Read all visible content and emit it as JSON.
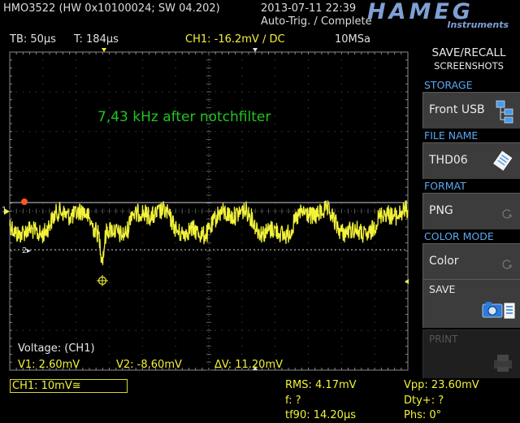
{
  "header": {
    "model": "HMO3522 (HW 0x10100024; SW 04.202)",
    "datetime": "2013-07-11 22:39",
    "status": "Auto-Trig. / Complete",
    "logo": "HAMEG",
    "logo_sub": "Instruments"
  },
  "info_bar": {
    "timebase": "TB: 50µs",
    "trigger_time": "T: 184µs",
    "ch1": "CH1: -16.2mV ∕ DC",
    "sample_rate": "10MSa"
  },
  "screen": {
    "annotation": "7,43 kHz after notchfilter",
    "annotation_color": "#22c422",
    "trace_color": "#f2f23a",
    "grid_color": "#5a5a5a",
    "marker_1": "1",
    "marker_2": "2"
  },
  "cursor_readout": {
    "title": "Voltage: (CH1)",
    "v1": "V1: 2.60mV",
    "v2": "V2: -8.60mV",
    "dv": "ΔV: 11.20mV"
  },
  "channel_box": "CH1: 10mV≅",
  "measurements": {
    "rms": "RMS: 4.17mV",
    "vpp": "Vpp: 23.60mV",
    "freq": "f: ?",
    "duty": "Dty+: ?",
    "tf90": "tf90: 14.20µs",
    "phase": "Phs: 0°"
  },
  "side_menu": {
    "title_1": "SAVE/RECALL",
    "title_2": "SCREENSHOTS",
    "storage_head": "STORAGE",
    "storage_value": "Front USB",
    "storage_icon": "usb-folder-icon",
    "filename_head": "FILE NAME",
    "filename_value": "THD06",
    "filename_icon": "edit-file-icon",
    "format_head": "FORMAT",
    "format_value": "PNG",
    "format_icon": "rotate-icon",
    "colormode_head": "COLOR MODE",
    "colormode_value": "Color",
    "colormode_icon": "rotate-icon",
    "save_label": "SAVE",
    "save_icon": "camera-icon",
    "print_label": "PRINT",
    "print_icon": "printer-icon",
    "accent_color": "#5aa8f0"
  }
}
